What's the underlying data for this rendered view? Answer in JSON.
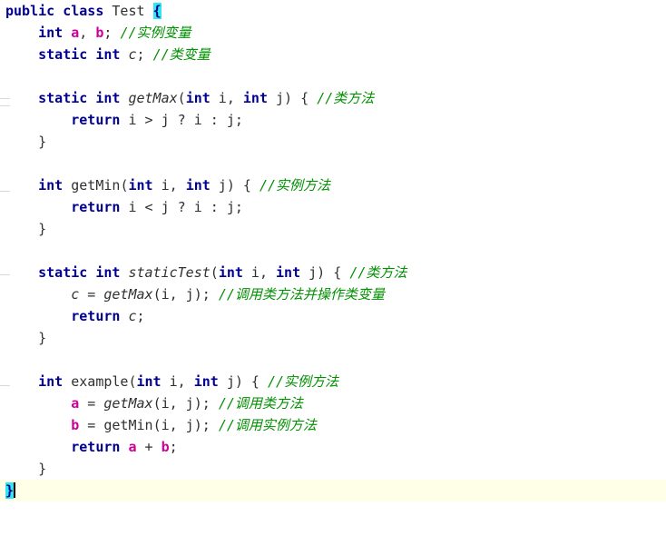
{
  "editor": {
    "name": "java-source-editor",
    "language": "Java",
    "background_color": "#ffffff",
    "current_line_highlight_color": "#fffee6",
    "bracket_match_color": "#33e5f0",
    "keyword_color": "#000090",
    "comment_color": "#009000",
    "instance_field_color": "#cc0099",
    "identifier_color": "#303030",
    "caret_visible": true,
    "caret_line": 24
  },
  "gutter": {
    "tick_positions": [
      108,
      116,
      210,
      302,
      424
    ]
  },
  "code": {
    "lines": [
      {
        "n": 1,
        "indent": 0,
        "current": false,
        "tokens": [
          {
            "t": "public",
            "c": "kw"
          },
          {
            "t": " ",
            "c": "plain"
          },
          {
            "t": "class",
            "c": "kw"
          },
          {
            "t": " ",
            "c": "plain"
          },
          {
            "t": "Test",
            "c": "ident"
          },
          {
            "t": " ",
            "c": "plain"
          },
          {
            "t": "{",
            "c": "brmatch"
          }
        ]
      },
      {
        "n": 2,
        "indent": 1,
        "current": false,
        "tokens": [
          {
            "t": "int",
            "c": "kw"
          },
          {
            "t": " ",
            "c": "plain"
          },
          {
            "t": "a",
            "c": "field"
          },
          {
            "t": ", ",
            "c": "punct"
          },
          {
            "t": "b",
            "c": "field"
          },
          {
            "t": "; ",
            "c": "punct"
          },
          {
            "t": "//实例变量",
            "c": "cmt"
          }
        ]
      },
      {
        "n": 3,
        "indent": 1,
        "current": false,
        "tokens": [
          {
            "t": "static",
            "c": "kw"
          },
          {
            "t": " ",
            "c": "plain"
          },
          {
            "t": "int",
            "c": "kw"
          },
          {
            "t": " ",
            "c": "plain"
          },
          {
            "t": "c",
            "c": "sfield"
          },
          {
            "t": "; ",
            "c": "punct"
          },
          {
            "t": "//类变量",
            "c": "cmt"
          }
        ]
      },
      {
        "n": 4,
        "indent": 0,
        "current": false,
        "tokens": []
      },
      {
        "n": 5,
        "indent": 1,
        "current": false,
        "tokens": [
          {
            "t": "static",
            "c": "kw"
          },
          {
            "t": " ",
            "c": "plain"
          },
          {
            "t": "int",
            "c": "kw"
          },
          {
            "t": " ",
            "c": "plain"
          },
          {
            "t": "getMax",
            "c": "smeth"
          },
          {
            "t": "(",
            "c": "punct"
          },
          {
            "t": "int",
            "c": "kw"
          },
          {
            "t": " i, ",
            "c": "punct"
          },
          {
            "t": "int",
            "c": "kw"
          },
          {
            "t": " j) { ",
            "c": "punct"
          },
          {
            "t": "//类方法",
            "c": "cmt"
          }
        ]
      },
      {
        "n": 6,
        "indent": 2,
        "current": false,
        "tokens": [
          {
            "t": "return",
            "c": "kw"
          },
          {
            "t": " i > j ? i : j;",
            "c": "punct"
          }
        ]
      },
      {
        "n": 7,
        "indent": 1,
        "current": false,
        "tokens": [
          {
            "t": "}",
            "c": "punct"
          }
        ]
      },
      {
        "n": 8,
        "indent": 0,
        "current": false,
        "tokens": []
      },
      {
        "n": 9,
        "indent": 1,
        "current": false,
        "tokens": [
          {
            "t": "int",
            "c": "kw"
          },
          {
            "t": " ",
            "c": "plain"
          },
          {
            "t": "getMin",
            "c": "meth"
          },
          {
            "t": "(",
            "c": "punct"
          },
          {
            "t": "int",
            "c": "kw"
          },
          {
            "t": " i, ",
            "c": "punct"
          },
          {
            "t": "int",
            "c": "kw"
          },
          {
            "t": " j) { ",
            "c": "punct"
          },
          {
            "t": "//实例方法",
            "c": "cmt"
          }
        ]
      },
      {
        "n": 10,
        "indent": 2,
        "current": false,
        "tokens": [
          {
            "t": "return",
            "c": "kw"
          },
          {
            "t": " i < j ? i : j;",
            "c": "punct"
          }
        ]
      },
      {
        "n": 11,
        "indent": 1,
        "current": false,
        "tokens": [
          {
            "t": "}",
            "c": "punct"
          }
        ]
      },
      {
        "n": 12,
        "indent": 0,
        "current": false,
        "tokens": []
      },
      {
        "n": 13,
        "indent": 1,
        "current": false,
        "tokens": [
          {
            "t": "static",
            "c": "kw"
          },
          {
            "t": " ",
            "c": "plain"
          },
          {
            "t": "int",
            "c": "kw"
          },
          {
            "t": " ",
            "c": "plain"
          },
          {
            "t": "staticTest",
            "c": "smeth"
          },
          {
            "t": "(",
            "c": "punct"
          },
          {
            "t": "int",
            "c": "kw"
          },
          {
            "t": " i, ",
            "c": "punct"
          },
          {
            "t": "int",
            "c": "kw"
          },
          {
            "t": " j) { ",
            "c": "punct"
          },
          {
            "t": "//类方法",
            "c": "cmt"
          }
        ]
      },
      {
        "n": 14,
        "indent": 2,
        "current": false,
        "tokens": [
          {
            "t": "c",
            "c": "sfield"
          },
          {
            "t": " = ",
            "c": "punct"
          },
          {
            "t": "getMax",
            "c": "smeth"
          },
          {
            "t": "(i, j); ",
            "c": "punct"
          },
          {
            "t": "//调用类方法并操作类变量",
            "c": "cmt"
          }
        ]
      },
      {
        "n": 15,
        "indent": 2,
        "current": false,
        "tokens": [
          {
            "t": "return",
            "c": "kw"
          },
          {
            "t": " ",
            "c": "plain"
          },
          {
            "t": "c",
            "c": "sfield"
          },
          {
            "t": ";",
            "c": "punct"
          }
        ]
      },
      {
        "n": 16,
        "indent": 1,
        "current": false,
        "tokens": [
          {
            "t": "}",
            "c": "punct"
          }
        ]
      },
      {
        "n": 17,
        "indent": 0,
        "current": false,
        "tokens": []
      },
      {
        "n": 18,
        "indent": 1,
        "current": false,
        "tokens": [
          {
            "t": "int",
            "c": "kw"
          },
          {
            "t": " ",
            "c": "plain"
          },
          {
            "t": "example",
            "c": "meth"
          },
          {
            "t": "(",
            "c": "punct"
          },
          {
            "t": "int",
            "c": "kw"
          },
          {
            "t": " i, ",
            "c": "punct"
          },
          {
            "t": "int",
            "c": "kw"
          },
          {
            "t": " j) { ",
            "c": "punct"
          },
          {
            "t": "//实例方法",
            "c": "cmt"
          }
        ]
      },
      {
        "n": 19,
        "indent": 2,
        "current": false,
        "tokens": [
          {
            "t": "a",
            "c": "field"
          },
          {
            "t": " = ",
            "c": "punct"
          },
          {
            "t": "getMax",
            "c": "smeth"
          },
          {
            "t": "(i, j); ",
            "c": "punct"
          },
          {
            "t": "//调用类方法",
            "c": "cmt"
          }
        ]
      },
      {
        "n": 20,
        "indent": 2,
        "current": false,
        "tokens": [
          {
            "t": "b",
            "c": "field"
          },
          {
            "t": " = ",
            "c": "punct"
          },
          {
            "t": "getMin",
            "c": "meth"
          },
          {
            "t": "(i, j); ",
            "c": "punct"
          },
          {
            "t": "//调用实例方法",
            "c": "cmt"
          }
        ]
      },
      {
        "n": 21,
        "indent": 2,
        "current": false,
        "tokens": [
          {
            "t": "return",
            "c": "kw"
          },
          {
            "t": " ",
            "c": "plain"
          },
          {
            "t": "a",
            "c": "field"
          },
          {
            "t": " + ",
            "c": "punct"
          },
          {
            "t": "b",
            "c": "field"
          },
          {
            "t": ";",
            "c": "punct"
          }
        ]
      },
      {
        "n": 22,
        "indent": 1,
        "current": false,
        "tokens": [
          {
            "t": "}",
            "c": "punct"
          }
        ]
      },
      {
        "n": 23,
        "indent": 0,
        "current": true,
        "caret_after": true,
        "tokens": [
          {
            "t": "}",
            "c": "brmatch"
          }
        ]
      }
    ]
  }
}
